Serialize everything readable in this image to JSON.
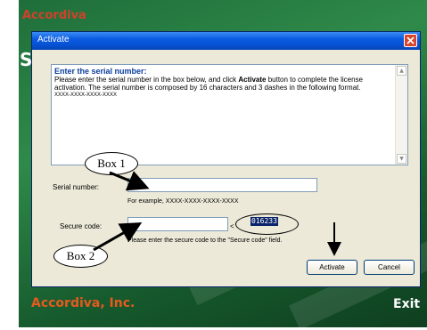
{
  "app": {
    "top_text": "Accordiva",
    "side_letter": "S",
    "logo": "Accordiva, Inc.",
    "exit_label": "Exit"
  },
  "dialog": {
    "title": "Activate",
    "close_icon": "close-icon",
    "info": {
      "heading": "Enter the serial number:",
      "line1_pre": "Please enter the serial number in the box below, and click ",
      "line1_bold": "Activate",
      "line1_post": " button to complete the license activation. The serial number is composed by 16 characters and 3 dashes in the following format.",
      "format": "XXXX-XXXX-XXXX-XXXX"
    },
    "serial_label": "Serial number:",
    "serial_value": "",
    "serial_example": "For example, XXXX-XXXX-XXXX-XXXX",
    "secure_label": "Secure code:",
    "secure_value": "",
    "arrow_prefix": "<",
    "code": "016233",
    "secure_hint": "Please enter the secure code to the \"Secure code\" field.",
    "activate_label": "Activate",
    "cancel_label": "Cancel"
  },
  "annotations": {
    "box1": "Box 1",
    "box2": "Box 2"
  }
}
